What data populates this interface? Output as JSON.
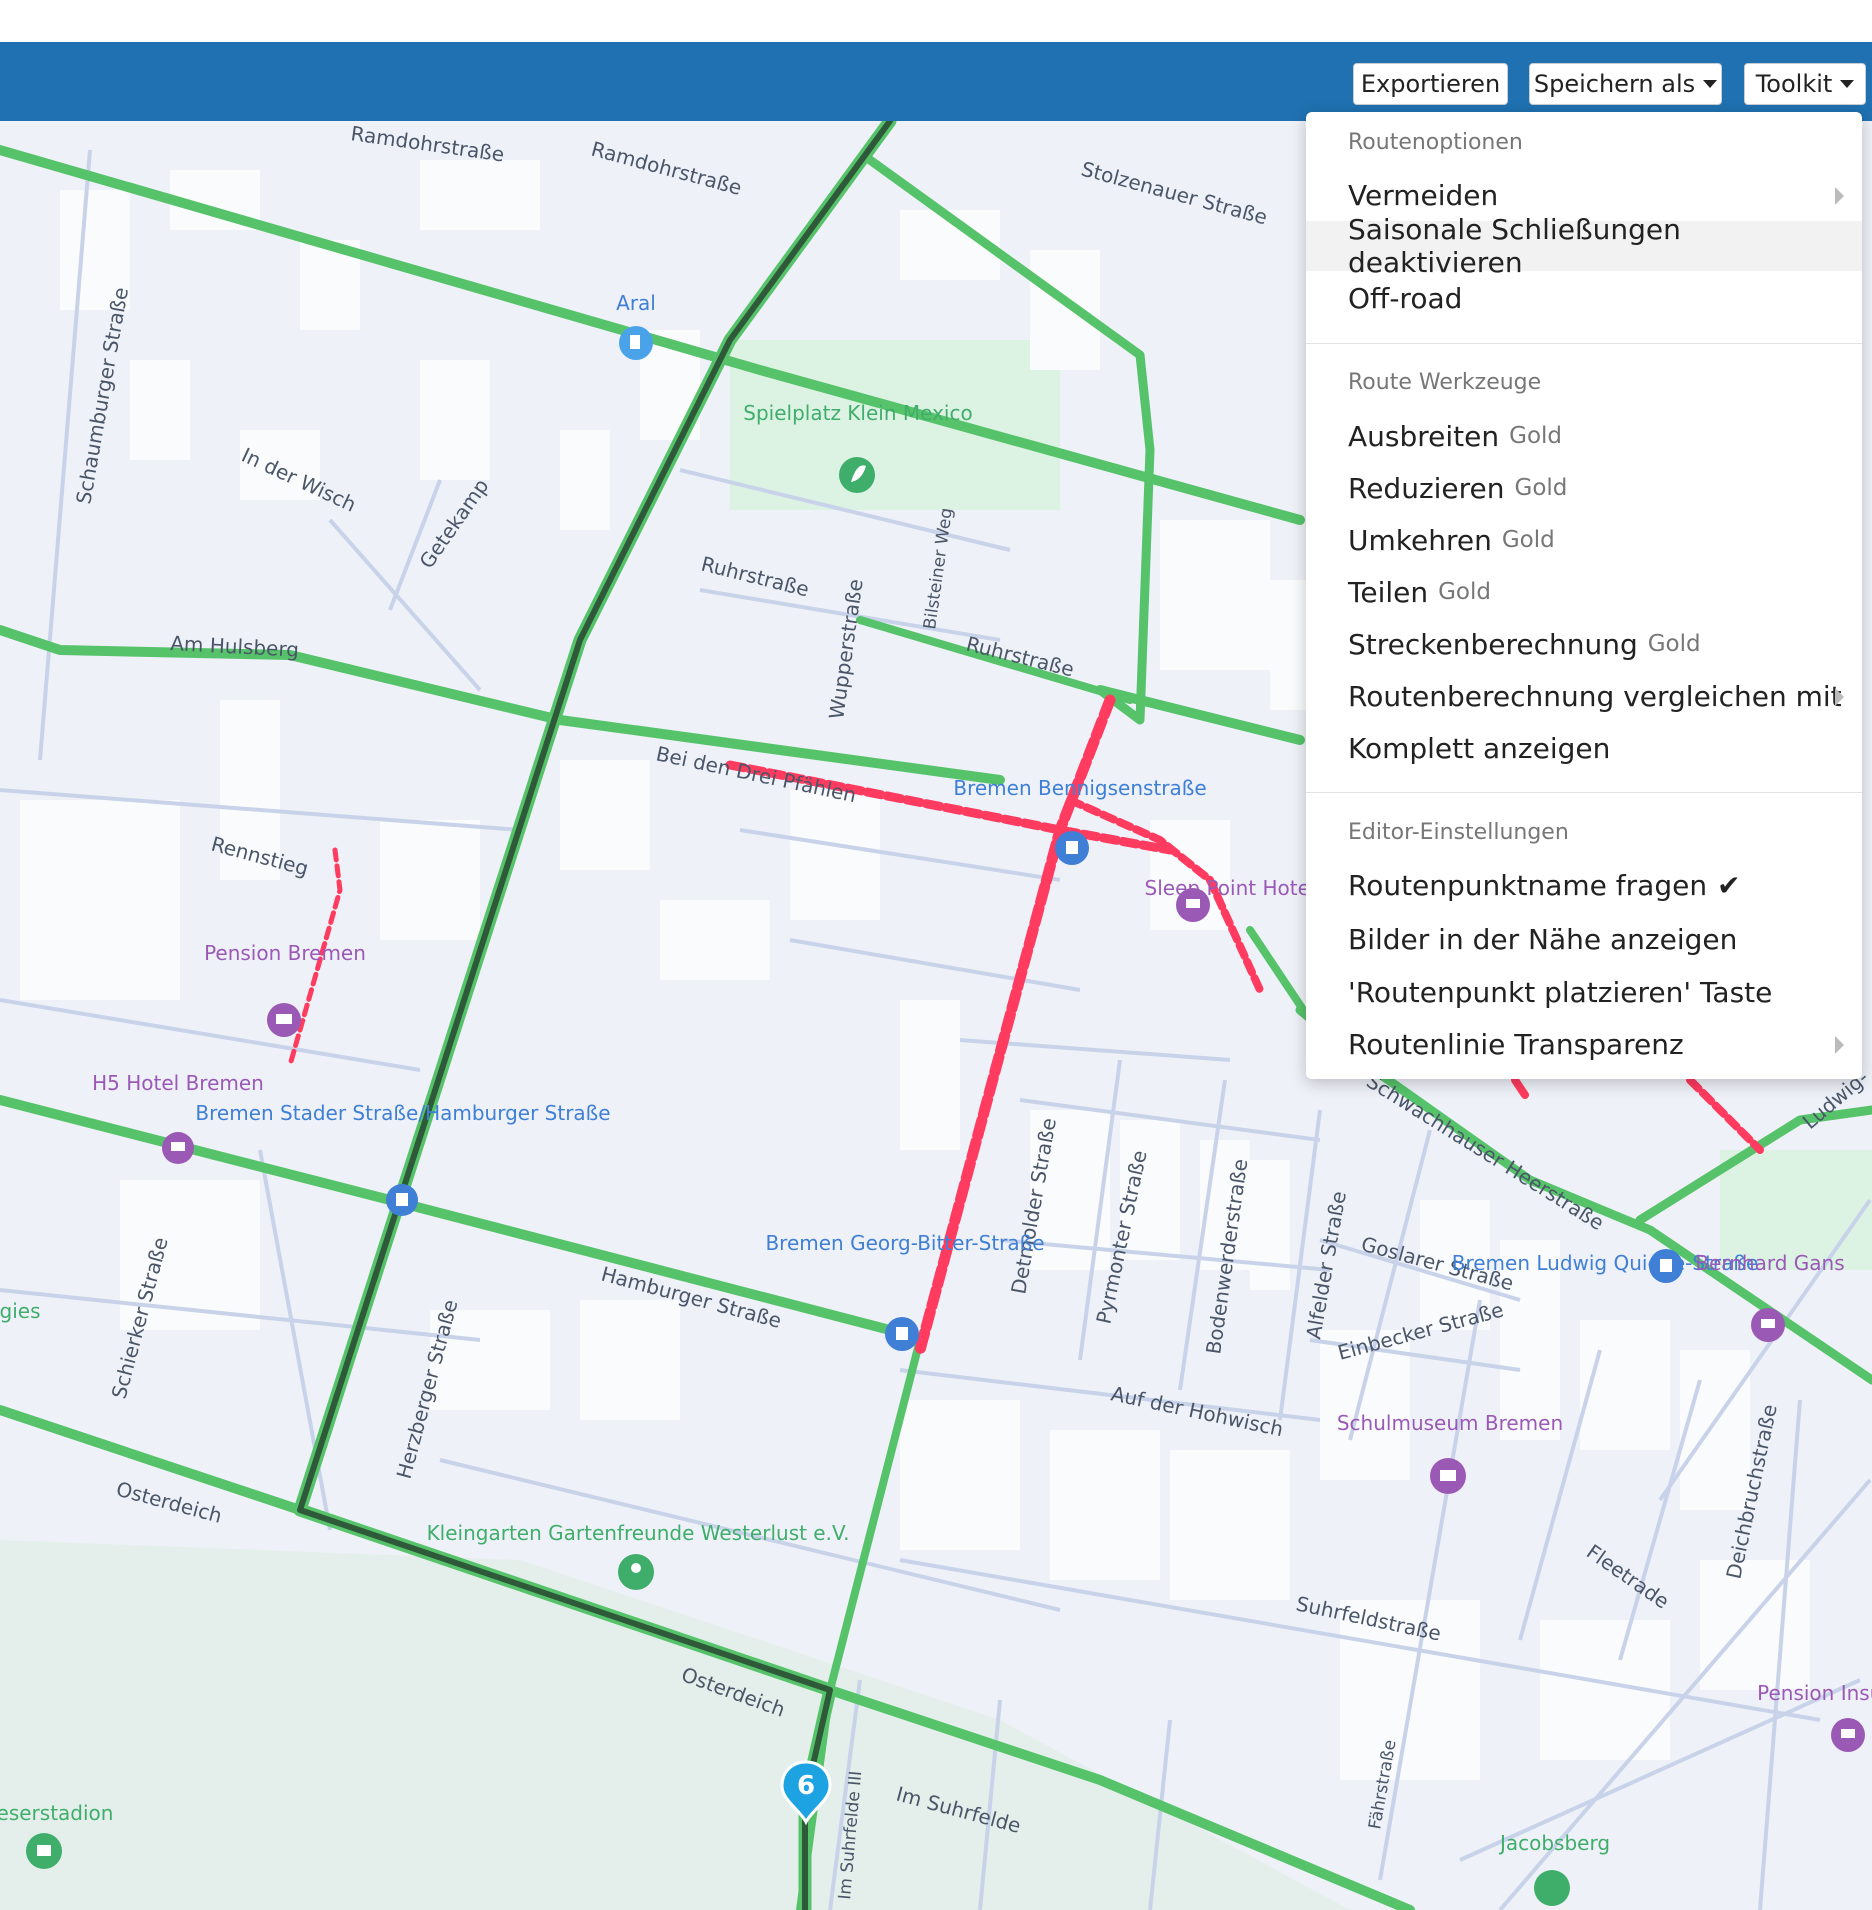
{
  "toolbar": {
    "export_label": "Exportieren",
    "save_as_label": "Speichern als",
    "toolkit_label": "Toolkit"
  },
  "menu": {
    "route_options_header": "Routenoptionen",
    "avoid": "Vermeiden",
    "seasonal": "Saisonale Schließungen deaktivieren",
    "offroad": "Off-road",
    "route_tools_header": "Route Werkzeuge",
    "expand": "Ausbreiten",
    "reduce": "Reduzieren",
    "reverse": "Umkehren",
    "split": "Teilen",
    "routing": "Streckenberechnung",
    "compare": "Routenberechnung vergleichen mit",
    "show_all": "Komplett anzeigen",
    "editor_header": "Editor-Einstellungen",
    "ask_name": "Routenpunktname fragen",
    "nearby_photos": "Bilder in der Nähe anzeigen",
    "place_key": "'Routenpunkt platzieren' Taste",
    "transparency": "Routenlinie Transparenz",
    "gold_badge": "Gold"
  },
  "waypoint": {
    "number": "6"
  },
  "map": {
    "streets": {
      "ramdohr1": "Ramdohrstraße",
      "ramdohr2": "Ramdohrstraße",
      "stolzenauer": "Stolzenauer Straße",
      "schaumburger": "Schaumburger Straße",
      "inderwisch": "In der Wisch",
      "getekamp": "Getekamp",
      "ruhr": "Ruhrstraße",
      "ruhr2": "Ruhrstraße",
      "wupper": "Wupperstraße",
      "bilsteiner": "Bilsteiner Weg",
      "amhulsberg": "Am Hulsberg",
      "beidendrei": "Bei den Drei Pfählen",
      "rennstieg": "Rennstieg",
      "hamburger": "Hamburger Straße",
      "herzberger": "Herzberger Straße",
      "schierker": "Schierker Straße",
      "osterdeich1": "Osterdeich",
      "osterdeich2": "Osterdeich",
      "detmolder": "Detmolder Straße",
      "pyrmonter": "Pyrmonter Straße",
      "bodenwerder": "Bodenwerderstraße",
      "alfelder": "Alfelder Straße",
      "goslarer": "Goslarer Straße",
      "einbecker": "Einbecker Straße",
      "hohwisch": "Auf der Hohwisch",
      "suhrfeld": "Suhrfeldstraße",
      "fleetrade": "Fleetrade",
      "deichbruch": "Deichbruchstraße",
      "imsuhrfelde": "Im Suhrfelde",
      "imsuhrfelde3": "Im Suhrfelde III",
      "faehr": "Fährstraße",
      "heerstr": "Schwachhauser Heerstraße",
      "ludwig": "Ludwig-"
    },
    "pois": {
      "spielplatz": "Spielplatz Klein Mexico",
      "pension_bremen": "Pension Bremen",
      "h5hotel": "H5 Hotel Bremen",
      "stop_staderstr": "Bremen Stader Straße/Hamburger Straße",
      "stop_bennigsen": "Bremen Bennigsenstraße",
      "sleeppoint": "Sleep Point Hotel",
      "stop_georgbitter": "Bremen Georg-Bitter-Straße",
      "stop_ludwigquidde": "Bremen Ludwig Quidde-Straße",
      "bernhard_gans": "Bernhard Gans",
      "schulmuseum": "Schulmuseum Bremen",
      "kleingarten": "Kleingarten Gartenfreunde Westerlust e.V.",
      "weserstadion": "eserstadion",
      "jacobsberg": "Jacobsberg",
      "pension_insulan": "Pension Insulan",
      "aral": "Aral",
      "ies": "gies"
    }
  },
  "colors": {
    "navbar": "#1f71b1",
    "route_green": "#56c36a",
    "route_dark": "#2f5a3a",
    "closure_red": "#ff3b5f",
    "transit_blue": "#3f7fd6",
    "poi_purple": "#9b59b6",
    "poi_green": "#3fae6b"
  }
}
